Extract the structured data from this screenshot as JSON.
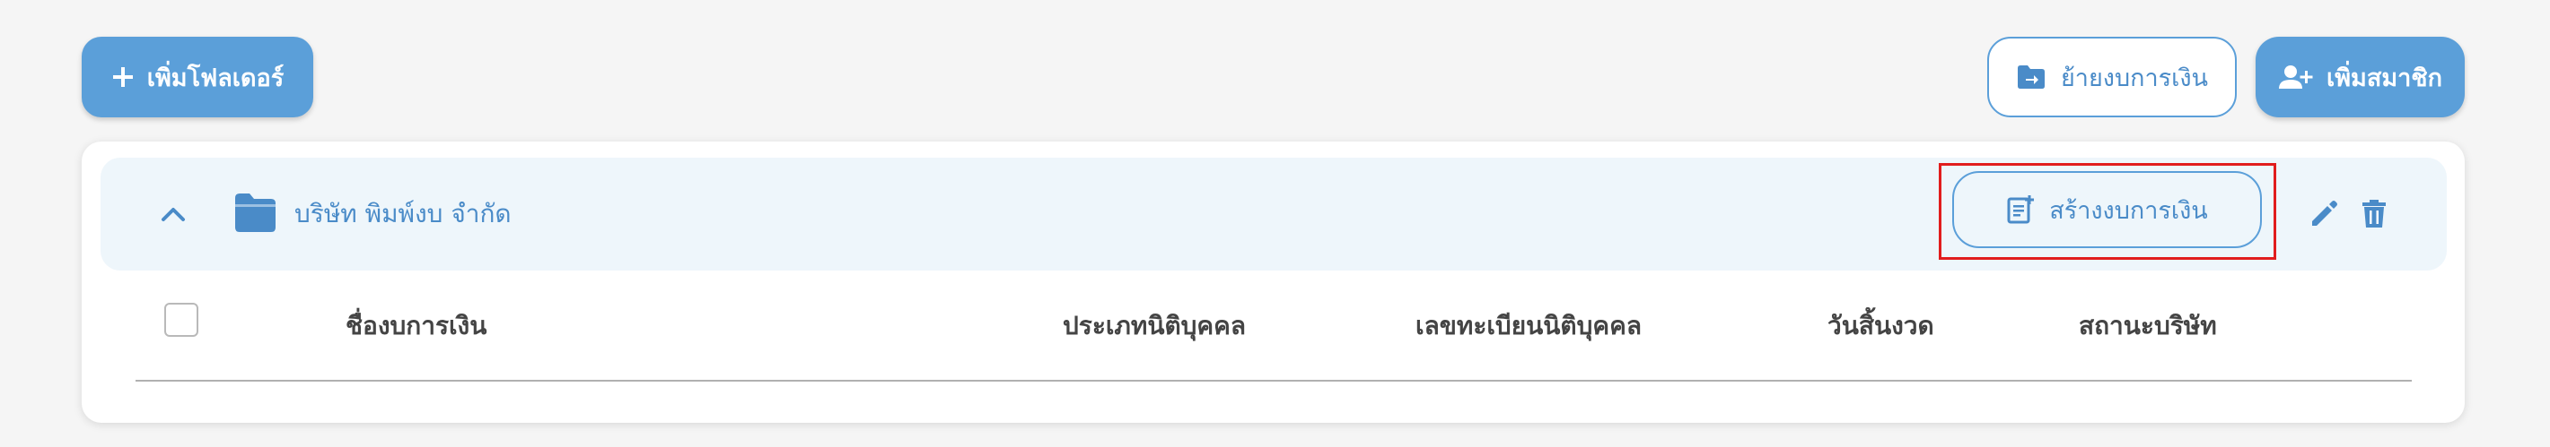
{
  "toolbar": {
    "add_folder_label": "เพิ่มโฟลเดอร์",
    "move_statement_label": "ย้ายงบการเงิน",
    "add_member_label": "เพิ่มสมาชิก"
  },
  "folder": {
    "name": "บริษัท พิมพ์งบ จำกัด",
    "create_statement_label": "สร้างงบการเงิน"
  },
  "table": {
    "columns": [
      "ชื่องบการเงิน",
      "ประเภทนิติบุคคล",
      "เลขทะเบียนนิติบุคคล",
      "วันสิ้นงวด",
      "สถานะบริษัท"
    ]
  },
  "colors": {
    "primary": "#5b9fd9",
    "primary_text": "#4a8bc8",
    "folder_row_bg": "#eef6fb",
    "highlight": "#e11d1d",
    "page_bg": "#f5f5f5"
  },
  "icons": {
    "add_folder": "plus-icon",
    "move_statement": "folder-move-icon",
    "add_member": "user-add-icon",
    "collapse": "chevron-up-icon",
    "folder": "folder-icon",
    "create_statement": "document-add-icon",
    "edit": "pencil-icon",
    "delete": "trash-icon"
  }
}
